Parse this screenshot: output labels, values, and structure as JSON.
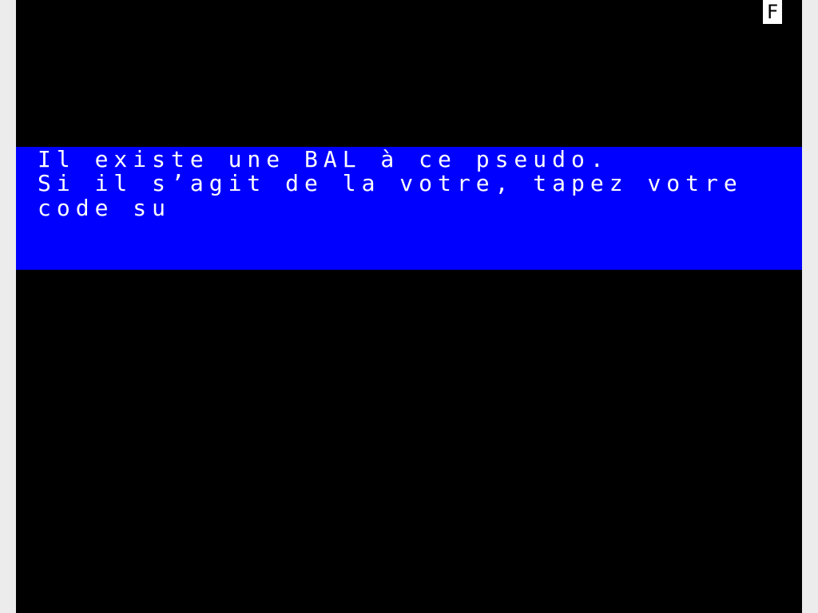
{
  "terminal": {
    "status_indicator": "F",
    "message": {
      "lines": [
        "Il existe une BAL à ce pseudo.",
        "Si il s’agit de la votre, tapez votre",
        "code su"
      ]
    },
    "colors": {
      "background": "#000000",
      "panel": "#0000ff",
      "text": "#ffffff",
      "indicator_background": "#ffffff",
      "indicator_text": "#000000"
    }
  }
}
